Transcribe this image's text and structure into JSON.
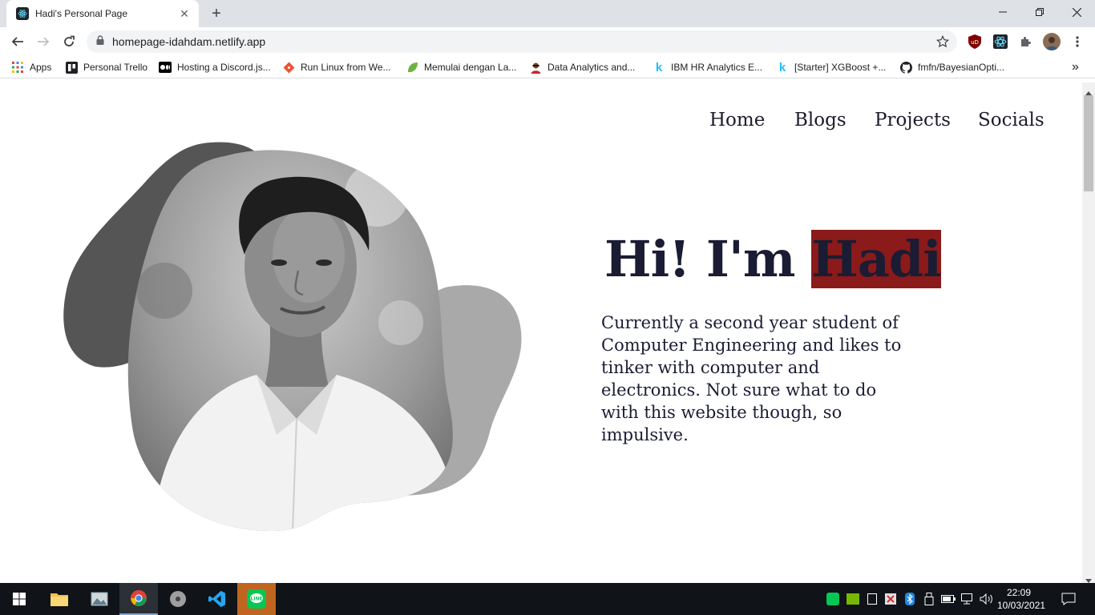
{
  "browser": {
    "tab_title": "Hadi's Personal Page",
    "tab_close": "✕",
    "new_tab": "+",
    "url": "homepage-idahdam.netlify.app",
    "bookmarks": [
      {
        "label": "Apps",
        "icon": "apps-grid-icon"
      },
      {
        "label": "Personal Trello",
        "icon": "trello-icon"
      },
      {
        "label": "Hosting a Discord.js...",
        "icon": "medium-icon"
      },
      {
        "label": "Run Linux from We...",
        "icon": "git-icon"
      },
      {
        "label": "Memulai dengan La...",
        "icon": "leaf-icon"
      },
      {
        "label": "Data Analytics and...",
        "icon": "avatar-icon"
      },
      {
        "label": "IBM HR Analytics E...",
        "icon": "kaggle-icon"
      },
      {
        "label": "[Starter] XGBoost +...",
        "icon": "kaggle-icon"
      },
      {
        "label": "fmfn/BayesianOpti...",
        "icon": "github-icon"
      }
    ],
    "bookmarks_overflow": "»"
  },
  "nav": {
    "items": [
      "Home",
      "Blogs",
      "Projects",
      "Socials"
    ]
  },
  "hero": {
    "greeting": "Hi! I'm ",
    "name": "Hadi",
    "description": "Currently a second year student of Computer Engineering and likes to tinker with computer and electronics. Not sure what to do with this website though, so impulsive."
  },
  "taskbar": {
    "time": "22:09",
    "date": "10/03/2021"
  },
  "colors": {
    "highlight": "#8b1a1a",
    "text": "#1a1c33",
    "blob_dark": "#555555",
    "blob_light": "#a9a9a9"
  }
}
